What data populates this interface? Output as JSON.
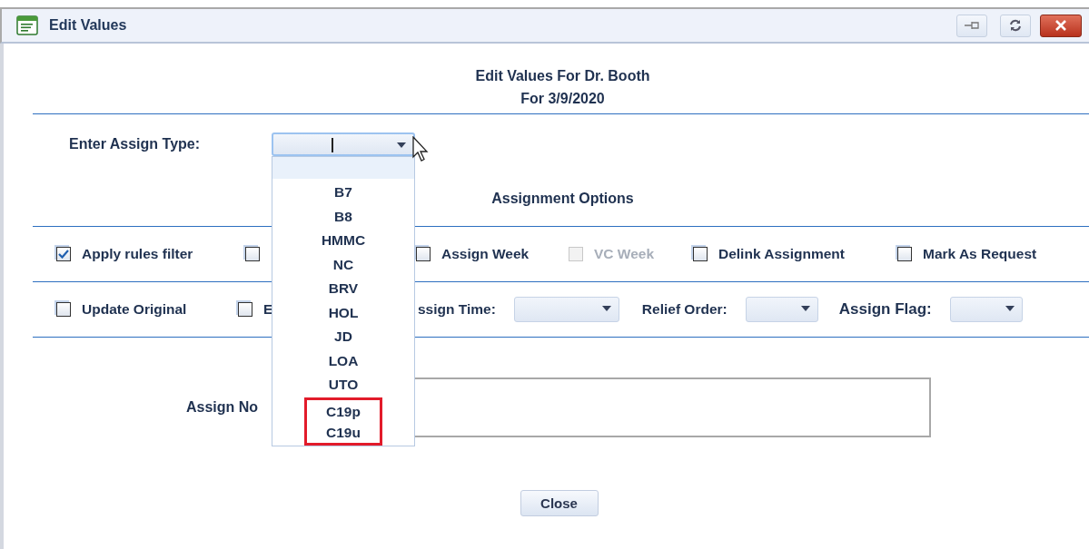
{
  "window": {
    "title": "Edit Values"
  },
  "heading": [
    "Edit Values For Dr. Booth",
    "For 3/9/2020"
  ],
  "assign_type": {
    "label": "Enter Assign Type:",
    "expanded": true,
    "options": [
      {
        "label": "B7",
        "highlighted": false
      },
      {
        "label": "B8",
        "highlighted": false
      },
      {
        "label": "HMMC",
        "highlighted": false
      },
      {
        "label": "NC",
        "highlighted": false
      },
      {
        "label": "BRV",
        "highlighted": false
      },
      {
        "label": "HOL",
        "highlighted": false
      },
      {
        "label": "JD",
        "highlighted": false
      },
      {
        "label": "LOA",
        "highlighted": false
      },
      {
        "label": "UTO",
        "highlighted": false
      },
      {
        "label": "C19p",
        "highlighted": true
      },
      {
        "label": "C19u",
        "highlighted": true
      }
    ]
  },
  "section_title": "Assignment Options",
  "row_1": [
    {
      "kind": "checkbox",
      "label": "Apply rules filter",
      "checked": true,
      "disabled": false
    },
    {
      "kind": "checkbox",
      "checked": false,
      "disabled": false
    },
    {
      "kind": "checkbox",
      "label": "Assign Week",
      "checked": false,
      "disabled": false
    },
    {
      "kind": "checkbox",
      "label": "VC Week",
      "checked": false,
      "disabled": true
    },
    {
      "kind": "checkbox",
      "label": "Delink Assignment",
      "checked": false,
      "disabled": false
    },
    {
      "kind": "checkbox",
      "label": "Mark As Request",
      "checked": false,
      "disabled": false
    }
  ],
  "row_2": [
    {
      "kind": "checkbox",
      "label": "Update Original",
      "checked": false,
      "disabled": false
    },
    {
      "kind": "checkbox",
      "label": "E",
      "checked": false,
      "disabled": false
    },
    {
      "kind": "combo",
      "label": "ssign Time:"
    },
    {
      "kind": "combo",
      "label": "Relief Order:"
    },
    {
      "kind": "combo",
      "label": "Assign Flag:"
    }
  ],
  "notes": {
    "label": "Assign No"
  },
  "buttons": [
    "Close"
  ]
}
